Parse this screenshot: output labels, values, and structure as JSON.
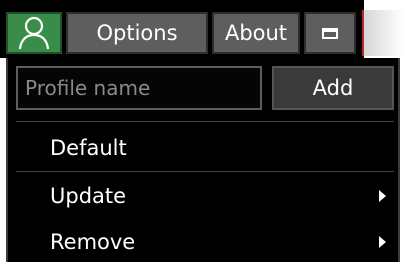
{
  "toolbar": {
    "profile_icon": "user-icon",
    "options_label": "Options",
    "about_label": "About",
    "window_icon": "window-icon"
  },
  "profile_form": {
    "name_value": "",
    "name_placeholder": "Profile name",
    "add_label": "Add"
  },
  "menu": {
    "items": [
      {
        "label": "Default",
        "has_submenu": false
      },
      {
        "label": "Update",
        "has_submenu": true
      },
      {
        "label": "Remove",
        "has_submenu": true
      }
    ]
  },
  "colors": {
    "profile_button": "#3a8d48",
    "toolbar_button": "#5e5e5e",
    "panel_background": "#000000",
    "accent_edge": "#c0282f"
  }
}
